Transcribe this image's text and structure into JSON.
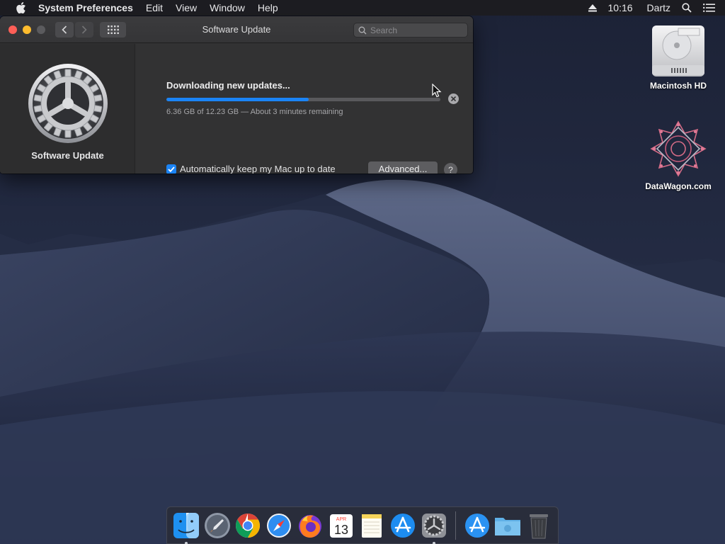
{
  "menubar": {
    "app_name": "System Preferences",
    "items": [
      "Edit",
      "View",
      "Window",
      "Help"
    ],
    "clock": "10:16",
    "user": "Dartz"
  },
  "window": {
    "title": "Software Update",
    "search_placeholder": "Search",
    "sidebar_label": "Software Update",
    "status_title": "Downloading new updates...",
    "status_detail": "6.36 GB of 12.23 GB — About 3 minutes remaining",
    "progress_fraction": 0.52,
    "auto_update_label": "Automatically keep my Mac up to date",
    "auto_update_checked": true,
    "advanced_label": "Advanced...",
    "help_label": "?"
  },
  "desktop_icons": [
    {
      "label": "Macintosh HD",
      "icon": "hard-drive-icon"
    },
    {
      "label": "DataWagon.com",
      "icon": "datawagon-logo-icon"
    }
  ],
  "dock": {
    "items": [
      {
        "name": "finder",
        "icon": "finder-icon",
        "running": true
      },
      {
        "name": "launchpad",
        "icon": "launchpad-icon",
        "running": false
      },
      {
        "name": "chrome",
        "icon": "chrome-icon",
        "running": false
      },
      {
        "name": "safari",
        "icon": "safari-icon",
        "running": false
      },
      {
        "name": "firefox",
        "icon": "firefox-icon",
        "running": false
      },
      {
        "name": "calendar",
        "icon": "calendar-icon",
        "running": false,
        "month": "APR",
        "day": "13"
      },
      {
        "name": "notes",
        "icon": "notes-icon",
        "running": false
      },
      {
        "name": "app-store",
        "icon": "app-store-icon",
        "running": false
      },
      {
        "name": "system-preferences",
        "icon": "system-preferences-icon",
        "running": true
      },
      {
        "name": "downloads-stack",
        "icon": "app-store-download-icon",
        "running": false
      },
      {
        "name": "downloads-folder",
        "icon": "folder-icon",
        "running": false
      },
      {
        "name": "trash",
        "icon": "trash-icon",
        "running": false
      }
    ]
  },
  "colors": {
    "accent": "#1b84f5",
    "close": "#fe5f57",
    "minimize": "#febc2e"
  }
}
